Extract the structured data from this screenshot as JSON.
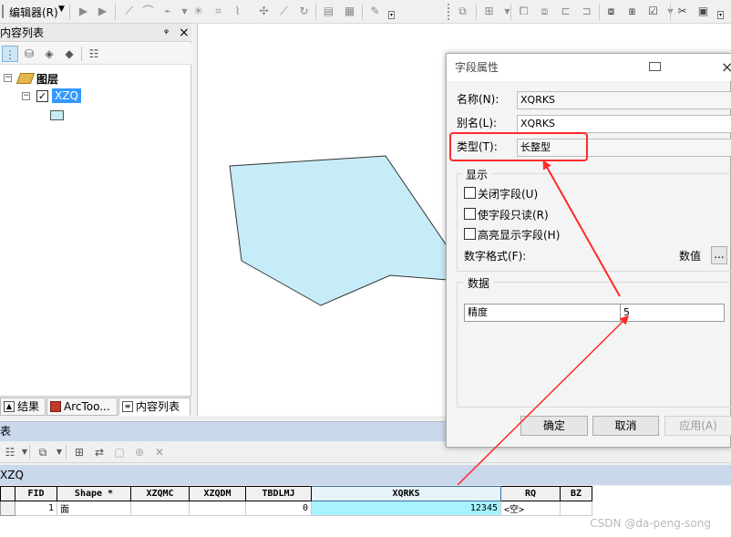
{
  "toolbar": {
    "editor_menu": "编辑器(R)",
    "editor_icon": "editor-pencil-icon"
  },
  "toc": {
    "title": "内容列表",
    "pin_glyph": "ᵠ",
    "close_glyph": "×",
    "tree_collapse": "⊟",
    "layers_group": "图层",
    "layer_name": "XZQ",
    "layer_fill": "#c6ecf7",
    "tabs": [
      {
        "label": "结果",
        "icon": "results-icon"
      },
      {
        "label": "ArcToo...",
        "icon": "arctoolbox-icon"
      },
      {
        "label": "内容列表",
        "icon": "toc-icon"
      }
    ]
  },
  "map": {
    "polygon_fill": "#c6ecf7",
    "polygon_stroke": "#333333",
    "annotation_color": "#ff2a2a"
  },
  "table_window": {
    "title": "表",
    "table_name": "XZQ",
    "columns": [
      "",
      "FID",
      "Shape *",
      "XZQMC",
      "XZQDM",
      "TBDLMJ",
      "XQRKS",
      "RQ",
      "BZ"
    ],
    "rows": [
      [
        "",
        "1",
        "面",
        "",
        "",
        "0",
        "12345",
        "<空>",
        ""
      ]
    ],
    "selected_column": "XQRKS"
  },
  "dialog": {
    "title": "字段属性",
    "name_label": "名称(N):",
    "name_value": "XQRKS",
    "alias_label": "别名(L):",
    "alias_value": "XQRKS",
    "type_label": "类型(T):",
    "type_value": "长整型",
    "display_group": "显示",
    "cb_off": "关闭字段(U)",
    "cb_readonly": "使字段只读(R)",
    "cb_highlight": "高亮显示字段(H)",
    "number_format_label": "数字格式(F):",
    "number_format_value": "数值",
    "ellipsis": "...",
    "data_group": "数据",
    "precision_label": "精度",
    "precision_value": "5",
    "ok": "确定",
    "cancel": "取消",
    "apply": "应用(A)"
  },
  "watermark": "CSDN @da-peng-song"
}
